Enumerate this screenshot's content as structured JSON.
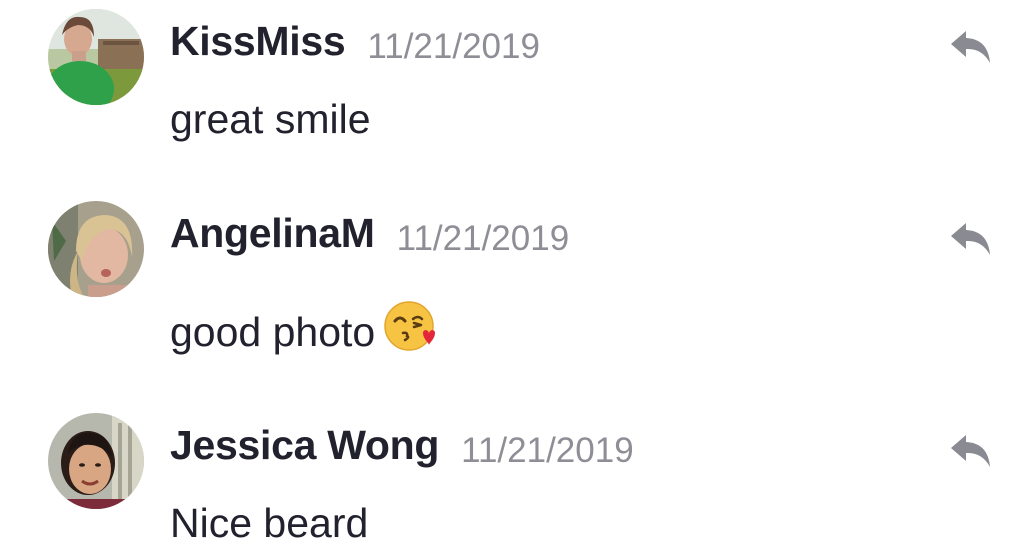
{
  "comments": [
    {
      "author": "KissMiss",
      "date": "11/21/2019",
      "text": "great smile",
      "avatar_icon": "avatar-kissmiss",
      "reply_icon": "reply-icon"
    },
    {
      "author": "AngelinaM",
      "date": "11/21/2019",
      "text": "good photo",
      "emoji": "face-blowing-a-kiss",
      "avatar_icon": "avatar-angelinam",
      "reply_icon": "reply-icon"
    },
    {
      "author": "Jessica Wong",
      "date": "11/21/2019",
      "text": "Nice beard",
      "avatar_icon": "avatar-jessica-wong",
      "reply_icon": "reply-icon"
    }
  ],
  "colors": {
    "author": "#22222e",
    "date": "#8e8e96",
    "text": "#22222e",
    "reply_icon": "#8a8a92"
  }
}
